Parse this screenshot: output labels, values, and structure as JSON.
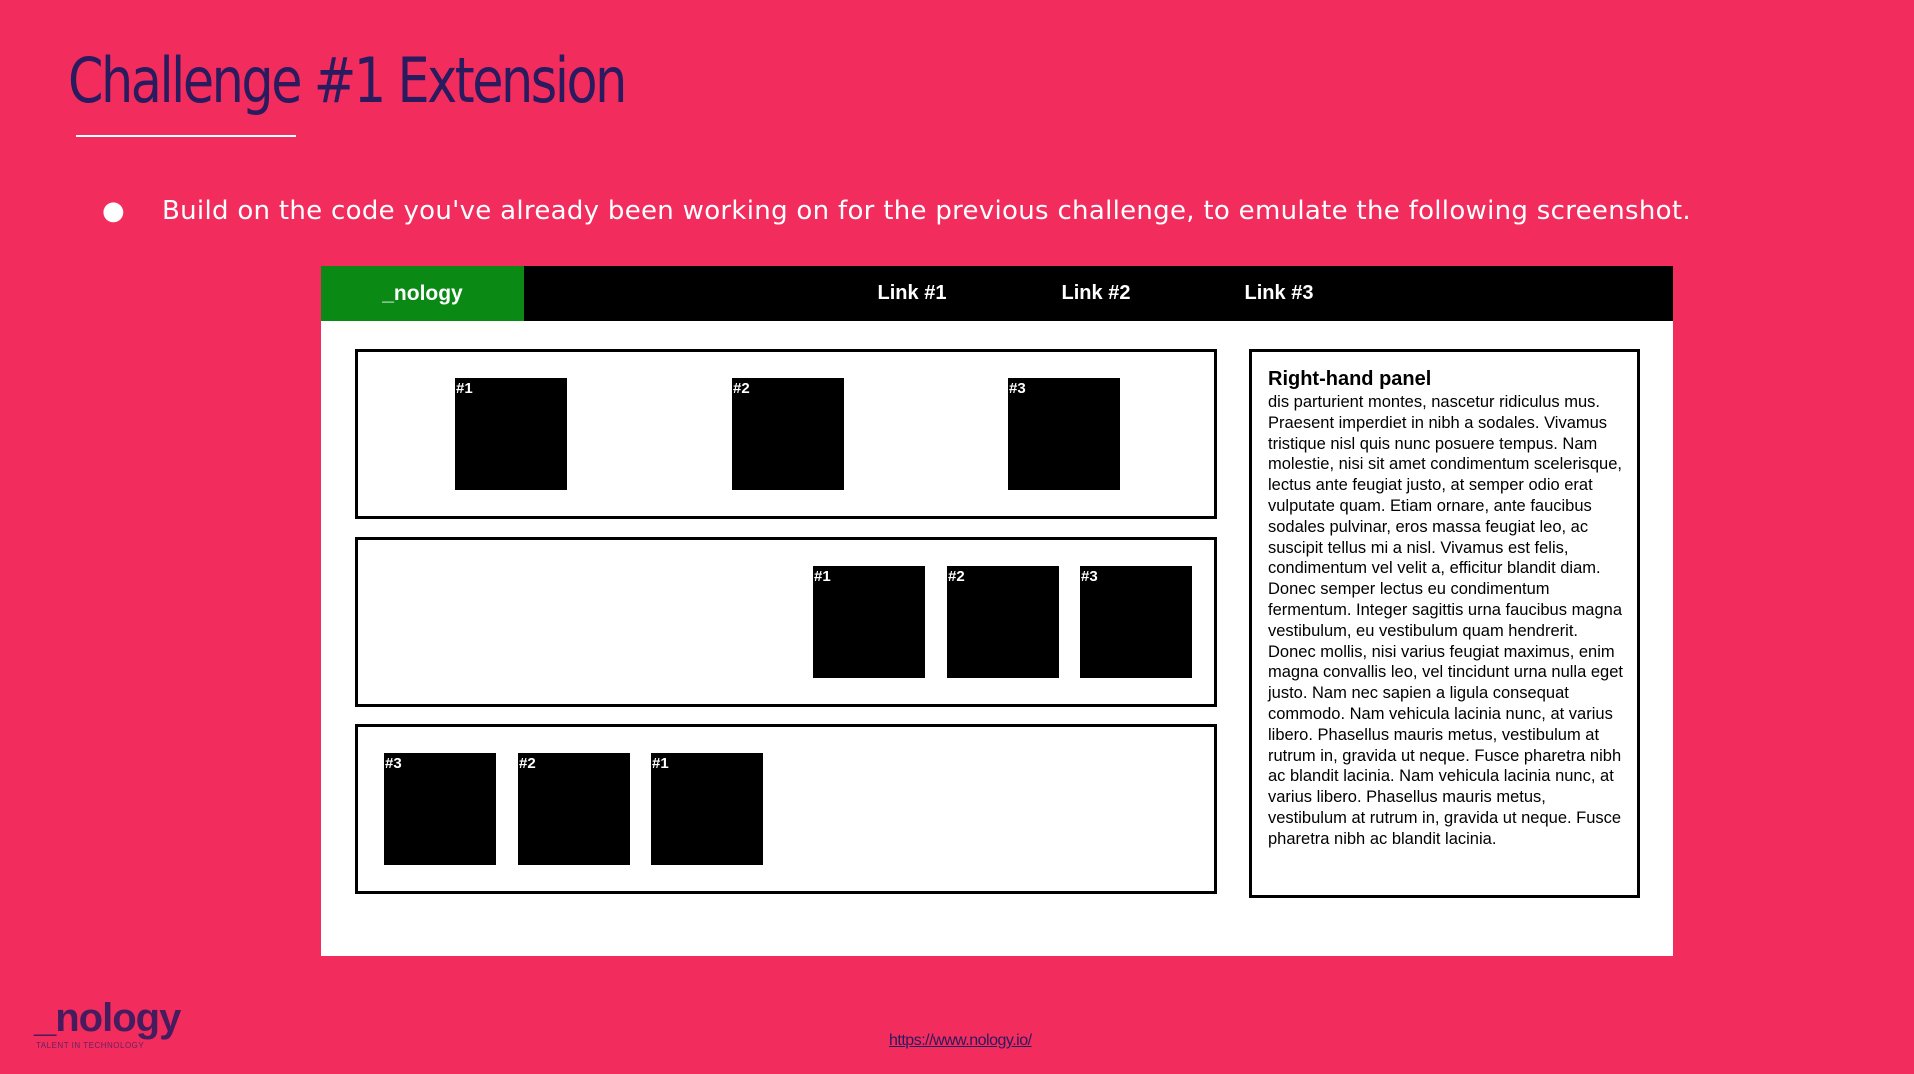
{
  "slide": {
    "title": "Challenge #1 Extension",
    "bullet_symbol": "●",
    "bullet_text": "Build on the code you've already been working on for the previous challenge, to emulate the following screenshot."
  },
  "mockup": {
    "brand": "_nology",
    "links": [
      "Link #1",
      "Link #2",
      "Link #3"
    ],
    "row1": [
      "#1",
      "#2",
      "#3"
    ],
    "row2": [
      "#1",
      "#2",
      "#3"
    ],
    "row3": [
      "#3",
      "#2",
      "#1"
    ],
    "panel": {
      "title": "Right-hand panel",
      "body": "dis parturient montes, nascetur ridiculus mus. Praesent imperdiet in nibh a sodales. Vivamus tristique nisl quis nunc posuere tempus. Nam molestie, nisi sit amet condimentum scelerisque, lectus ante feugiat justo, at semper odio erat vulputate quam. Etiam ornare, ante faucibus sodales pulvinar, eros massa feugiat leo, ac suscipit tellus mi a nisl. Vivamus est felis, condimentum vel velit a, efficitur blandit diam. Donec semper lectus eu condimentum fermentum. Integer sagittis urna faucibus magna vestibulum, eu vestibulum quam hendrerit. Donec mollis, nisi varius feugiat maximus, enim magna convallis leo, vel tincidunt urna nulla eget justo. Nam nec sapien a ligula consequat commodo. Nam vehicula lacinia nunc, at varius libero. Phasellus mauris metus, vestibulum at rutrum in, gravida ut neque. Fusce pharetra nibh ac blandit lacinia. Nam vehicula lacinia nunc, at varius libero. Phasellus mauris metus, vestibulum at rutrum in, gravida ut neque. Fusce pharetra nibh ac blandit lacinia."
    }
  },
  "footer": {
    "logo": "_nology",
    "tagline": "TALENT IN TECHNOLOGY",
    "url": "https://www.nology.io/"
  },
  "colors": {
    "background": "#f22d5e",
    "title": "#2a1a5e",
    "brand_green": "#0a8a14"
  }
}
